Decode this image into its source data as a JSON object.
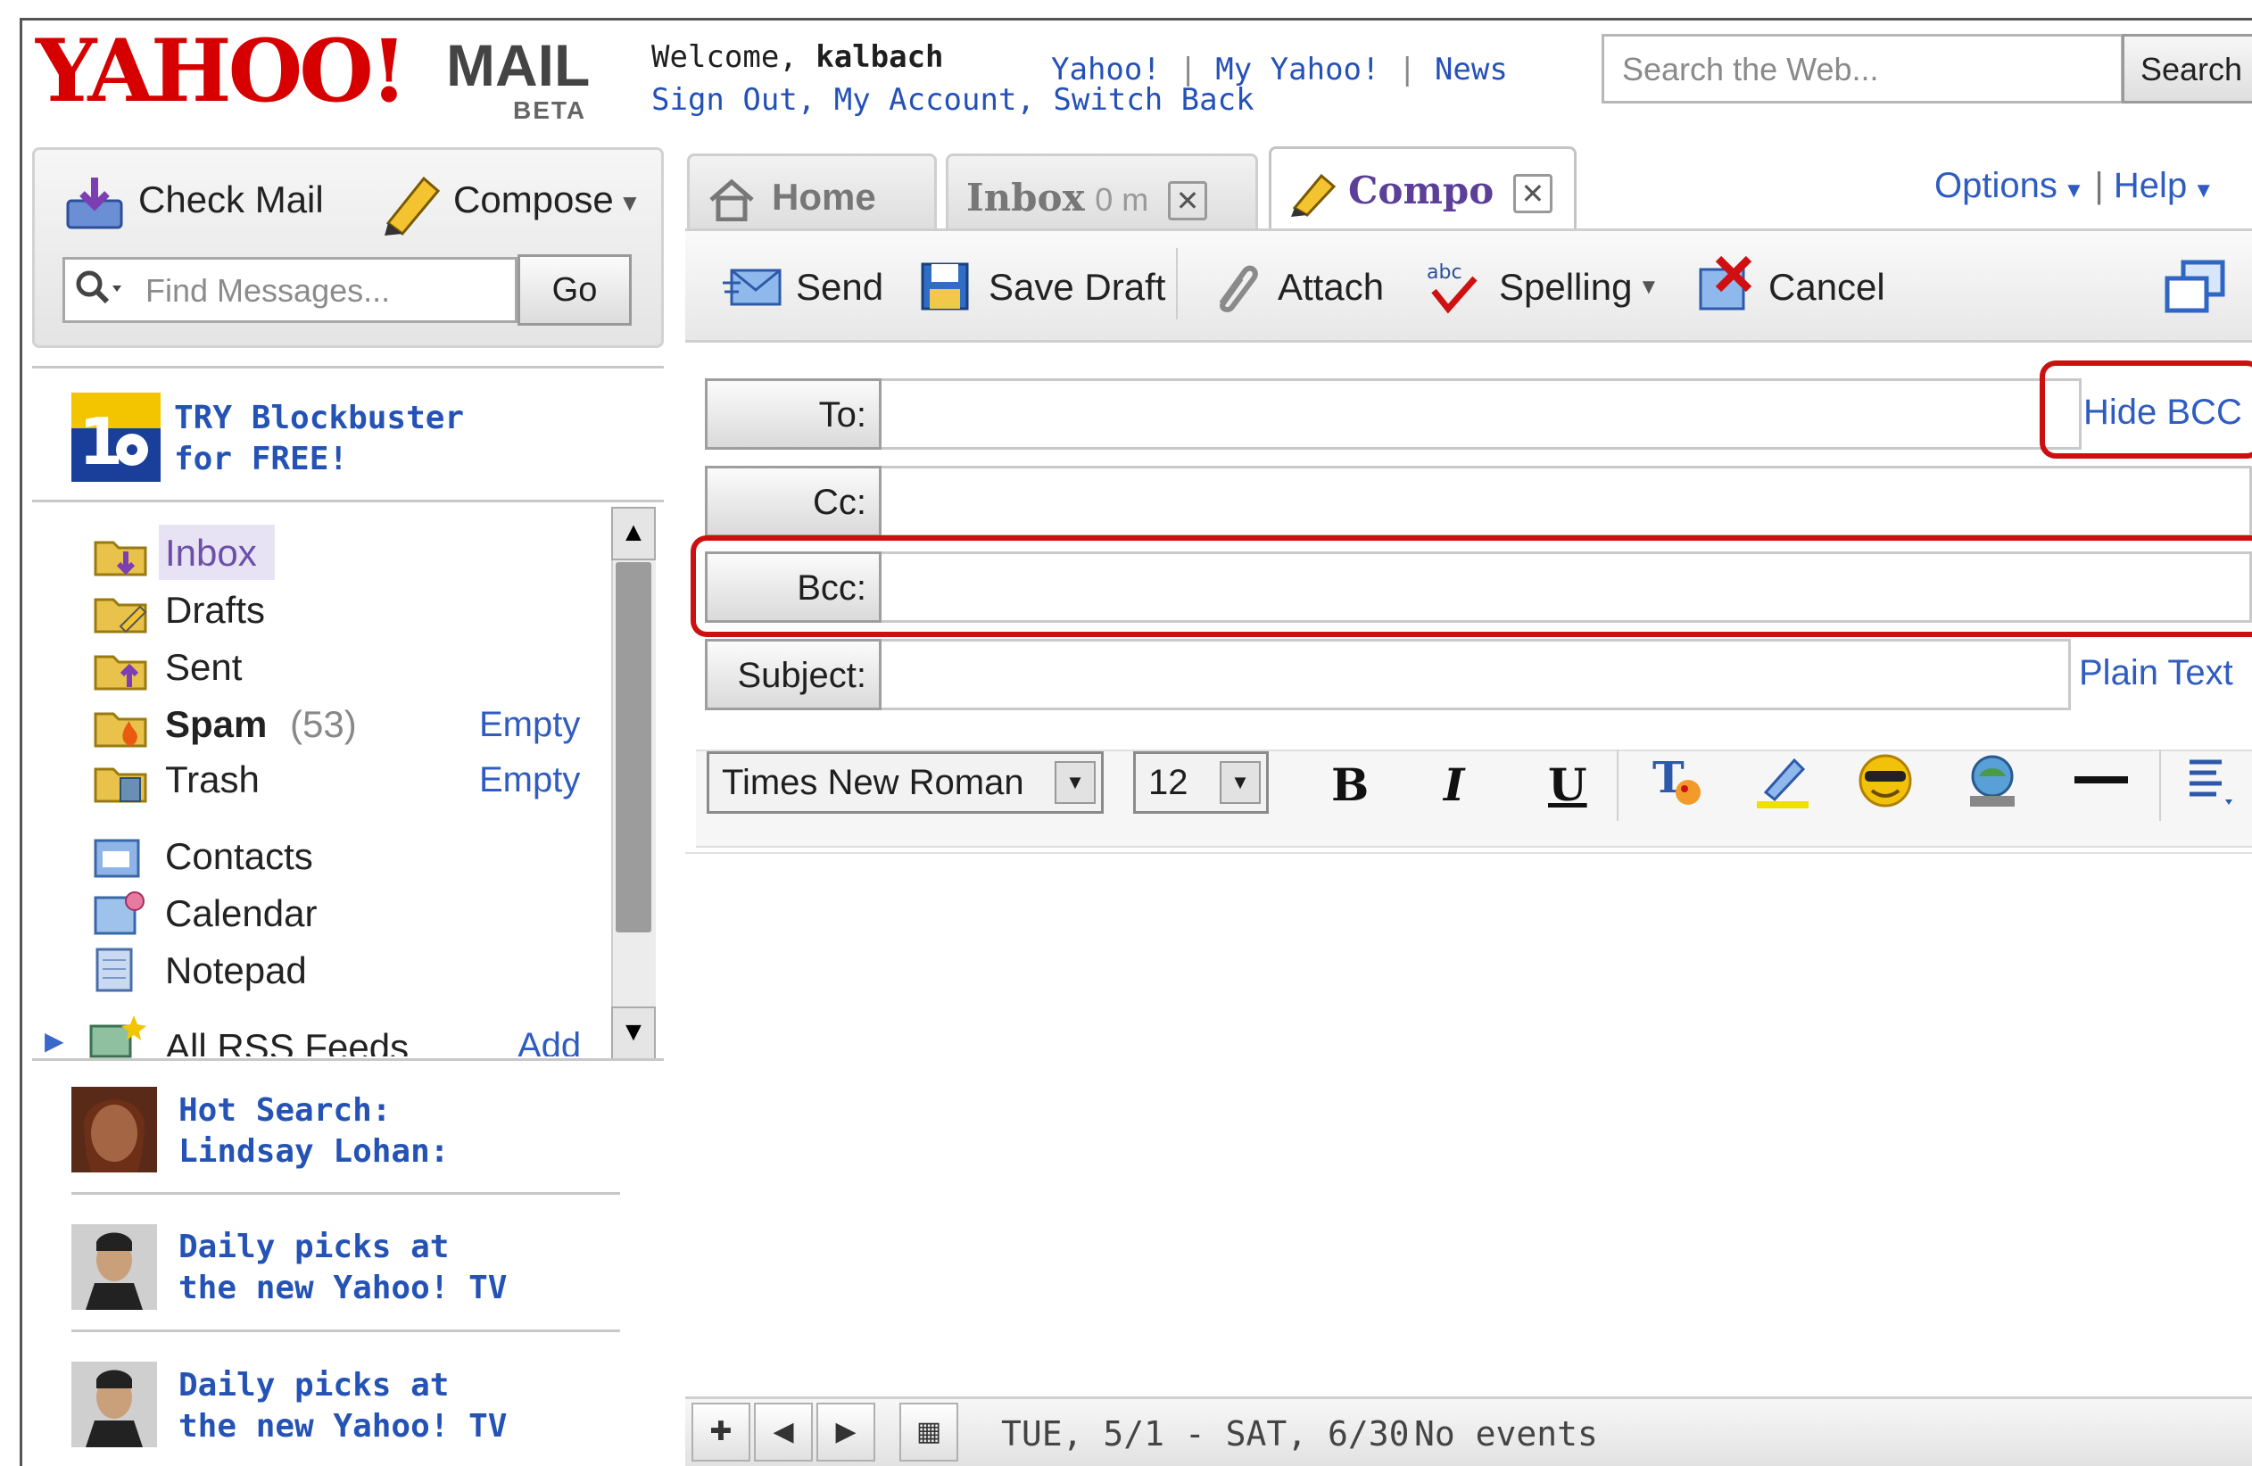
{
  "header": {
    "logo_yahoo": "YAHOO!",
    "logo_mail": "MAIL",
    "logo_beta": "BETA",
    "welcome_prefix": "Welcome, ",
    "username": "kalbach",
    "links_top": [
      "Yahoo!",
      "My Yahoo!",
      "News"
    ],
    "links_bottom": [
      "Sign Out",
      "My Account",
      "Switch Back"
    ],
    "search_placeholder": "Search the Web...",
    "search_button": "Search"
  },
  "left_toolbar": {
    "check_mail": "Check Mail",
    "compose": "Compose",
    "find_placeholder": "Find Messages...",
    "go": "Go"
  },
  "promo_top": {
    "line1": "TRY Blockbuster",
    "line2": "for FREE!"
  },
  "folders": [
    {
      "name": "Inbox",
      "count": "",
      "action": ""
    },
    {
      "name": "Drafts",
      "count": "",
      "action": ""
    },
    {
      "name": "Sent",
      "count": "",
      "action": ""
    },
    {
      "name": "Spam",
      "count": "(53)",
      "action": "Empty"
    },
    {
      "name": "Trash",
      "count": "",
      "action": "Empty"
    }
  ],
  "apps": [
    "Contacts",
    "Calendar",
    "Notepad"
  ],
  "rss": {
    "label": "All RSS Feeds",
    "action": "Add"
  },
  "promos": [
    {
      "line1": "Hot Search:",
      "line2": "Lindsay Lohan:"
    },
    {
      "line1": "Daily picks at",
      "line2": "the new Yahoo! TV"
    },
    {
      "line1": "Daily picks at",
      "line2": "the new Yahoo! TV"
    }
  ],
  "tabs": {
    "home": "Home",
    "inbox": "Inbox",
    "inbox_count": "0 m",
    "compose": "Compo"
  },
  "top_right": {
    "options": "Options",
    "help": "Help"
  },
  "actions": {
    "send": "Send",
    "save_draft": "Save Draft",
    "attach": "Attach",
    "spelling": "Spelling",
    "cancel": "Cancel"
  },
  "fields": {
    "to": "To:",
    "cc": "Cc:",
    "bcc": "Bcc:",
    "subject": "Subject:",
    "hide_bcc": "Hide BCC",
    "plain_text": "Plain Text"
  },
  "format": {
    "font": "Times New Roman",
    "size": "12",
    "bold": "B",
    "italic": "I",
    "underline": "U"
  },
  "calendar_bar": {
    "range": "TUE, 5/1 - SAT, 6/30",
    "events": "No events"
  },
  "colors": {
    "brand_red": "#d60000",
    "link_blue": "#2451b8",
    "highlight_red": "#cc1010",
    "active_tab_text": "#5b3f99"
  }
}
